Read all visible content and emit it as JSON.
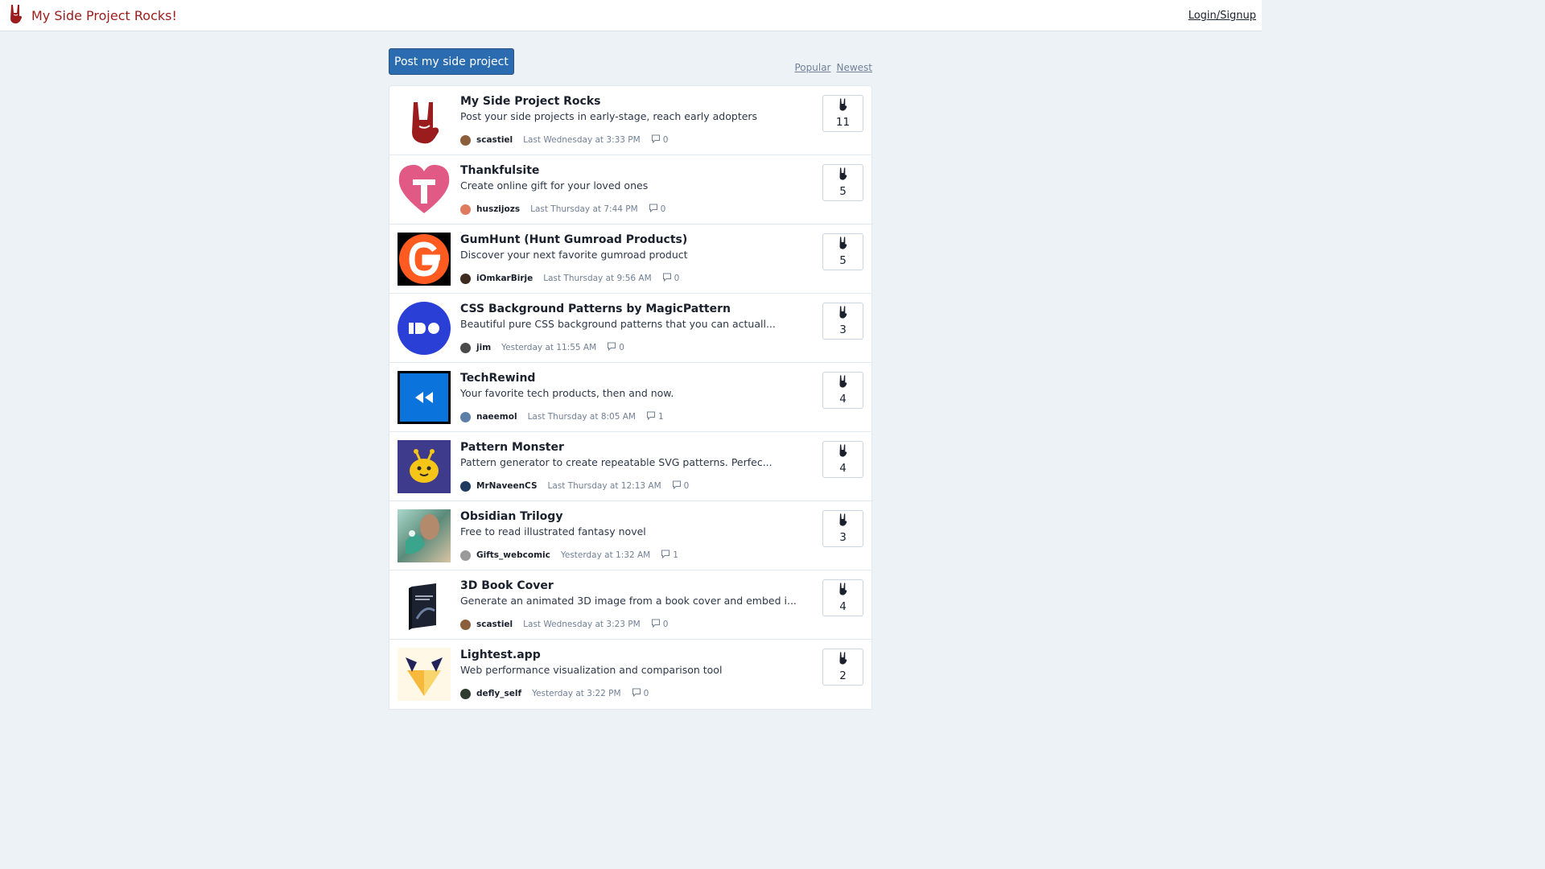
{
  "header": {
    "title": "My Side Project Rocks!",
    "login_label": "Login/Signup"
  },
  "actions": {
    "post_label": "Post my side project",
    "sort_popular": "Popular",
    "sort_newest": "Newest"
  },
  "projects": [
    {
      "title": "My Side Project Rocks",
      "description": "Post your side projects in early-stage, reach early adopters",
      "user": "scastiel",
      "time": "Last Wednesday at 3:33 PM",
      "comments": "0",
      "votes": "11",
      "avatar_color": "#8b5e3c"
    },
    {
      "title": "Thankfulsite",
      "description": "Create online gift for your loved ones",
      "user": "huszijozs",
      "time": "Last Thursday at 7:44 PM",
      "comments": "0",
      "votes": "5",
      "avatar_color": "#e07a5f"
    },
    {
      "title": "GumHunt (Hunt Gumroad Products)",
      "description": "Discover your next favorite gumroad product",
      "user": "iOmkarBirje",
      "time": "Last Thursday at 9:56 AM",
      "comments": "0",
      "votes": "5",
      "avatar_color": "#3d2b1f"
    },
    {
      "title": "CSS Background Patterns by MagicPattern",
      "description": "Beautiful pure CSS background patterns that you can actuall...",
      "user": "jim",
      "time": "Yesterday at 11:55 AM",
      "comments": "0",
      "votes": "3",
      "avatar_color": "#4a4a4a"
    },
    {
      "title": "TechRewind",
      "description": "Your favorite tech products, then and now.",
      "user": "naeemol",
      "time": "Last Thursday at 8:05 AM",
      "comments": "1",
      "votes": "4",
      "avatar_color": "#5b7fa6"
    },
    {
      "title": "Pattern Monster",
      "description": "Pattern generator to create repeatable SVG patterns. Perfec...",
      "user": "MrNaveenCS",
      "time": "Last Thursday at 12:13 AM",
      "comments": "0",
      "votes": "4",
      "avatar_color": "#1f3a5f"
    },
    {
      "title": "Obsidian Trilogy",
      "description": "Free to read illustrated fantasy novel",
      "user": "Gifts_webcomic",
      "time": "Yesterday at 1:32 AM",
      "comments": "1",
      "votes": "3",
      "avatar_color": "#9a9a9a"
    },
    {
      "title": "3D Book Cover",
      "description": "Generate an animated 3D image from a book cover and embed i...",
      "user": "scastiel",
      "time": "Last Wednesday at 3:23 PM",
      "comments": "0",
      "votes": "4",
      "avatar_color": "#8b5e3c"
    },
    {
      "title": "Lightest.app",
      "description": "Web performance visualization and comparison tool",
      "user": "defly_self",
      "time": "Yesterday at 3:22 PM",
      "comments": "0",
      "votes": "2",
      "avatar_color": "#2f3b2f"
    }
  ],
  "icons": {
    "brand": "rock-hand-icon",
    "vote": "rock-hand-icon",
    "comment": "comment-icon"
  },
  "colors": {
    "brand": "#9b1c1c",
    "primary_button": "#2b6cb0",
    "background": "#edf2f7"
  }
}
